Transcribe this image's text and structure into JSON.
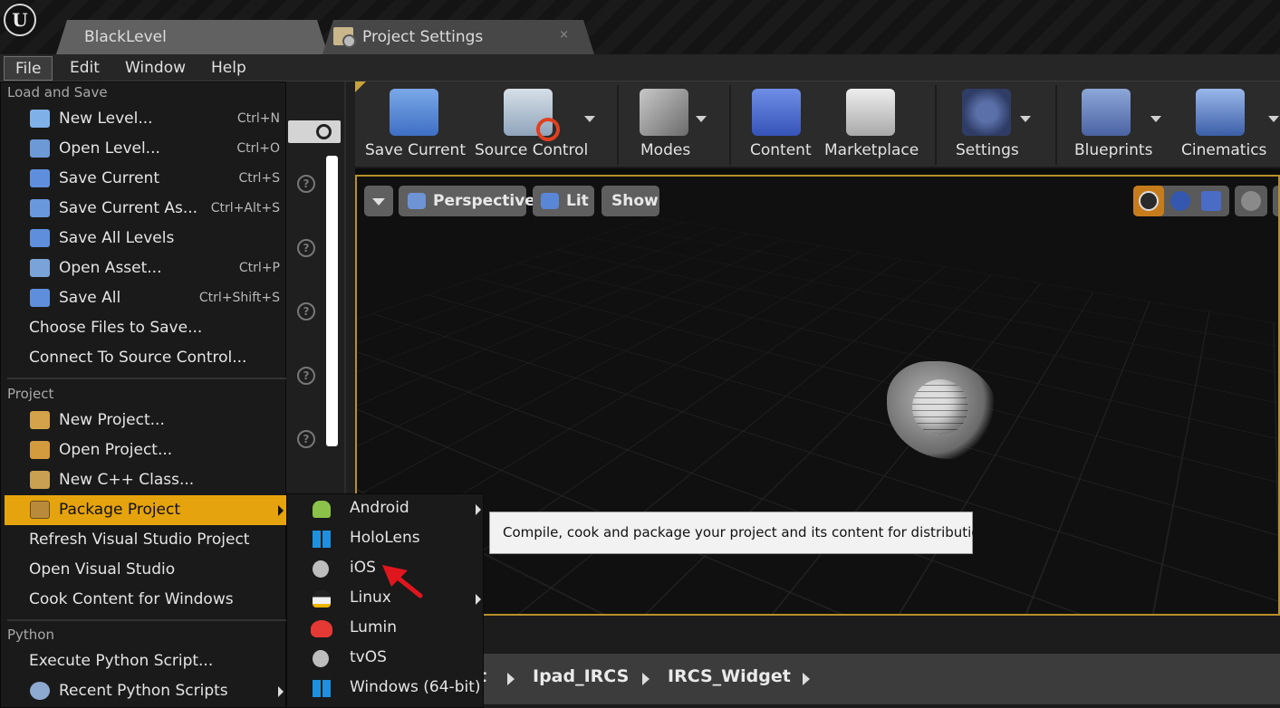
{
  "tabs": [
    {
      "label": "BlackLevel",
      "active": false
    },
    {
      "label": "Project Settings",
      "close": "×"
    }
  ],
  "menubar": {
    "items": [
      "File",
      "Edit",
      "Window",
      "Help"
    ]
  },
  "file_menu": {
    "sections": [
      {
        "header": "Load and Save",
        "items": [
          {
            "label": "New Level...",
            "shortcut": "Ctrl+N",
            "icon": "new-level-icon"
          },
          {
            "label": "Open Level...",
            "shortcut": "Ctrl+O",
            "icon": "open-level-icon"
          },
          {
            "label": "Save Current",
            "shortcut": "Ctrl+S",
            "icon": "save-icon"
          },
          {
            "label": "Save Current As...",
            "shortcut": "Ctrl+Alt+S",
            "icon": "save-as-icon"
          },
          {
            "label": "Save All Levels",
            "shortcut": "",
            "icon": "save-all-levels-icon"
          },
          {
            "label": "Open Asset...",
            "shortcut": "Ctrl+P",
            "icon": "open-asset-icon"
          },
          {
            "label": "Save All",
            "shortcut": "Ctrl+Shift+S",
            "icon": "save-all-icon"
          },
          {
            "label": "Choose Files to Save...",
            "shortcut": ""
          },
          {
            "label": "Connect To Source Control...",
            "shortcut": ""
          }
        ]
      },
      {
        "header": "Project",
        "items": [
          {
            "label": "New Project...",
            "icon": "new-project-icon"
          },
          {
            "label": "Open Project...",
            "icon": "open-project-icon"
          },
          {
            "label": "New C++ Class...",
            "icon": "new-cpp-class-icon"
          },
          {
            "label": "Package Project",
            "icon": "package-icon",
            "highlighted": true
          },
          {
            "label": "Refresh Visual Studio Project"
          },
          {
            "label": "Open Visual Studio"
          },
          {
            "label": "Cook Content for Windows"
          }
        ]
      },
      {
        "header": "Python",
        "items": [
          {
            "label": "Execute Python Script..."
          },
          {
            "label": "Recent Python Scripts",
            "icon": "recent-scripts-icon"
          }
        ]
      }
    ]
  },
  "package_submenu": {
    "items": [
      {
        "label": "Android",
        "icon": "android-icon",
        "has_submenu": true
      },
      {
        "label": "HoloLens",
        "icon": "windows-icon"
      },
      {
        "label": "iOS",
        "icon": "apple-icon"
      },
      {
        "label": "Linux",
        "icon": "linux-icon",
        "has_submenu": true
      },
      {
        "label": "Lumin",
        "icon": "lumin-icon"
      },
      {
        "label": "tvOS",
        "icon": "tvos-icon"
      },
      {
        "label": "Windows (64-bit)",
        "icon": "windows-icon"
      }
    ]
  },
  "tooltip": "Compile, cook and package your project and its content for distribution.",
  "toolbar": {
    "buttons": [
      {
        "label": "Save Current",
        "icon": "save-icon"
      },
      {
        "label": "Source Control",
        "icon": "source-control-icon"
      },
      {
        "label": "Modes",
        "icon": "modes-icon"
      },
      {
        "label": "Content",
        "icon": "content-icon"
      },
      {
        "label": "Marketplace",
        "icon": "marketplace-icon"
      },
      {
        "label": "Settings",
        "icon": "settings-icon"
      },
      {
        "label": "Blueprints",
        "icon": "blueprints-icon"
      },
      {
        "label": "Cinematics",
        "icon": "cinematics-icon"
      }
    ]
  },
  "viewport": {
    "perspective_label": "Perspective",
    "lit_label": "Lit",
    "show_label": "Show"
  },
  "breadcrumb": {
    "partial": "t",
    "items": [
      "Ipad_IRCS",
      "IRCS_Widget"
    ]
  },
  "colors": {
    "highlight": "#e5a40d",
    "viewport_border": "#b8902a",
    "annotation_arrow": "#e0161e"
  }
}
